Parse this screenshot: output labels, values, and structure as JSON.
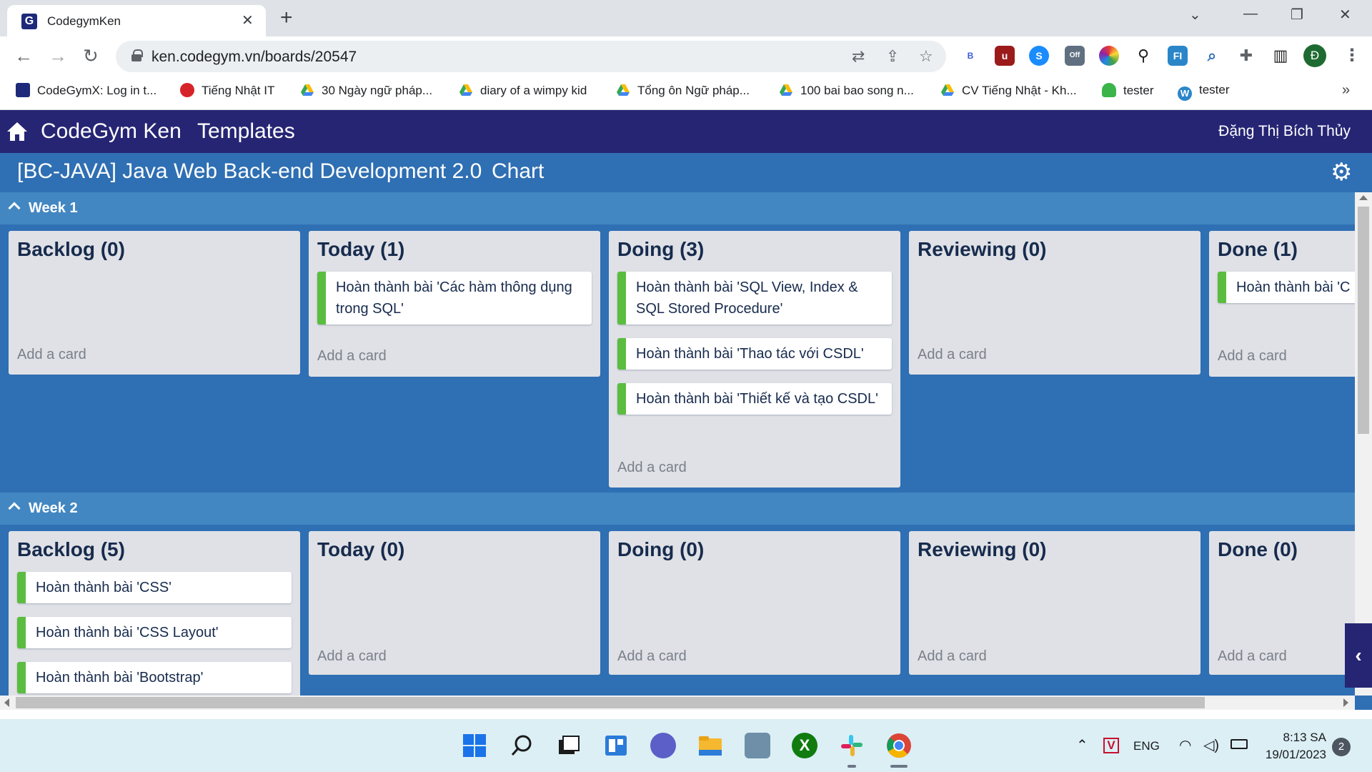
{
  "browser": {
    "tab_title": "CodegymKen",
    "tab_favicon": "G",
    "url": "ken.codegym.vn/boards/20547",
    "avatar_letter": "Đ",
    "bookmarks": [
      {
        "label": "CodeGymX: Log in t...",
        "icon": "codegym-icon",
        "color": "#1d2a7a"
      },
      {
        "label": "Tiếng Nhật IT",
        "icon": "red-circle-icon",
        "color": "#d6232a"
      },
      {
        "label": "30 Ngày ngữ pháp...",
        "icon": "drive-icon",
        "color": "#fbbc04"
      },
      {
        "label": "diary of a wimpy kid",
        "icon": "drive-icon",
        "color": "#fbbc04"
      },
      {
        "label": "Tổng ôn Ngữ pháp...",
        "icon": "drive-icon",
        "color": "#fbbc04"
      },
      {
        "label": "100 bai bao song n...",
        "icon": "drive-icon",
        "color": "#fbbc04"
      },
      {
        "label": "CV Tiếng Nhật - Kh...",
        "icon": "drive-icon",
        "color": "#fbbc04"
      },
      {
        "label": "tester",
        "icon": "green-cloud-icon",
        "color": "#3bb54a"
      },
      {
        "label": "tester",
        "icon": "wordpress-icon",
        "color": "#2a86c8"
      }
    ],
    "bookmark_more": "»"
  },
  "app": {
    "title": "CodeGym Ken",
    "templates": "Templates",
    "user": "Đặng Thị Bích Thủy",
    "board_title": "[BC-JAVA] Java Web Back-end Development 2.0",
    "chart_link": "Chart",
    "add_card": "Add a card",
    "weeks": [
      {
        "label": "Week 1",
        "lists": [
          {
            "title": "Backlog (0)",
            "cards": []
          },
          {
            "title": "Today (1)",
            "cards": [
              "Hoàn thành bài 'Các hàm thông dụng trong SQL'"
            ]
          },
          {
            "title": "Doing (3)",
            "cards": [
              "Hoàn thành bài 'SQL View, Index & SQL Stored Procedure'",
              "Hoàn thành bài 'Thao tác với CSDL'",
              "Hoàn thành bài 'Thiết kế và tạo CSDL'"
            ]
          },
          {
            "title": "Reviewing (0)",
            "cards": []
          },
          {
            "title": "Done (1)",
            "cards": [
              "Hoàn thành bài 'C hệ'"
            ]
          }
        ]
      },
      {
        "label": "Week 2",
        "lists": [
          {
            "title": "Backlog (5)",
            "cards": [
              "Hoàn thành bài 'CSS'",
              "Hoàn thành bài 'CSS Layout'",
              "Hoàn thành bài 'Bootstrap'"
            ]
          },
          {
            "title": "Today (0)",
            "cards": []
          },
          {
            "title": "Doing (0)",
            "cards": []
          },
          {
            "title": "Reviewing (0)",
            "cards": []
          },
          {
            "title": "Done (0)",
            "cards": []
          }
        ]
      }
    ]
  },
  "taskbar": {
    "language": "ENG",
    "time": "8:13 SA",
    "date": "19/01/2023",
    "notifications": "2"
  },
  "colors": {
    "header": "#262574",
    "board": "#2f6fb3",
    "week_header": "#4387c2",
    "card_label": "#5bbd3f"
  }
}
